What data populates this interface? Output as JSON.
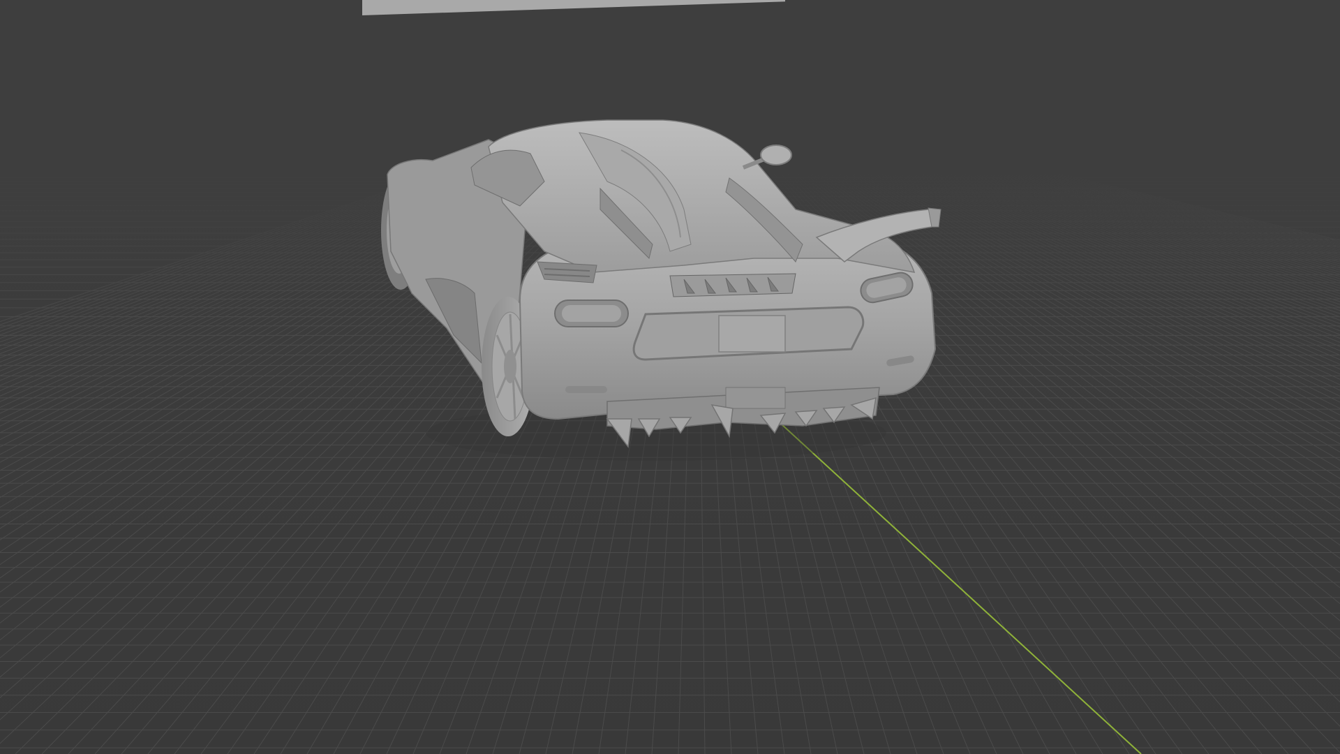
{
  "app": {
    "editor": "3D Viewport",
    "shading_mode": "solid",
    "show_floor_grid": true
  },
  "scene": {
    "object": "car-model-rear-view",
    "reference_plane": "reference-image-plane"
  },
  "colors": {
    "background": "#3d3d3d",
    "grid_line": "#4b4b4b",
    "y_axis": "#8fb239",
    "model_base": "#9c9c9c",
    "model_highlight": "#c4c4c4",
    "model_shadow": "#6f6f6f",
    "reference_plane": "#a9a9a9"
  }
}
